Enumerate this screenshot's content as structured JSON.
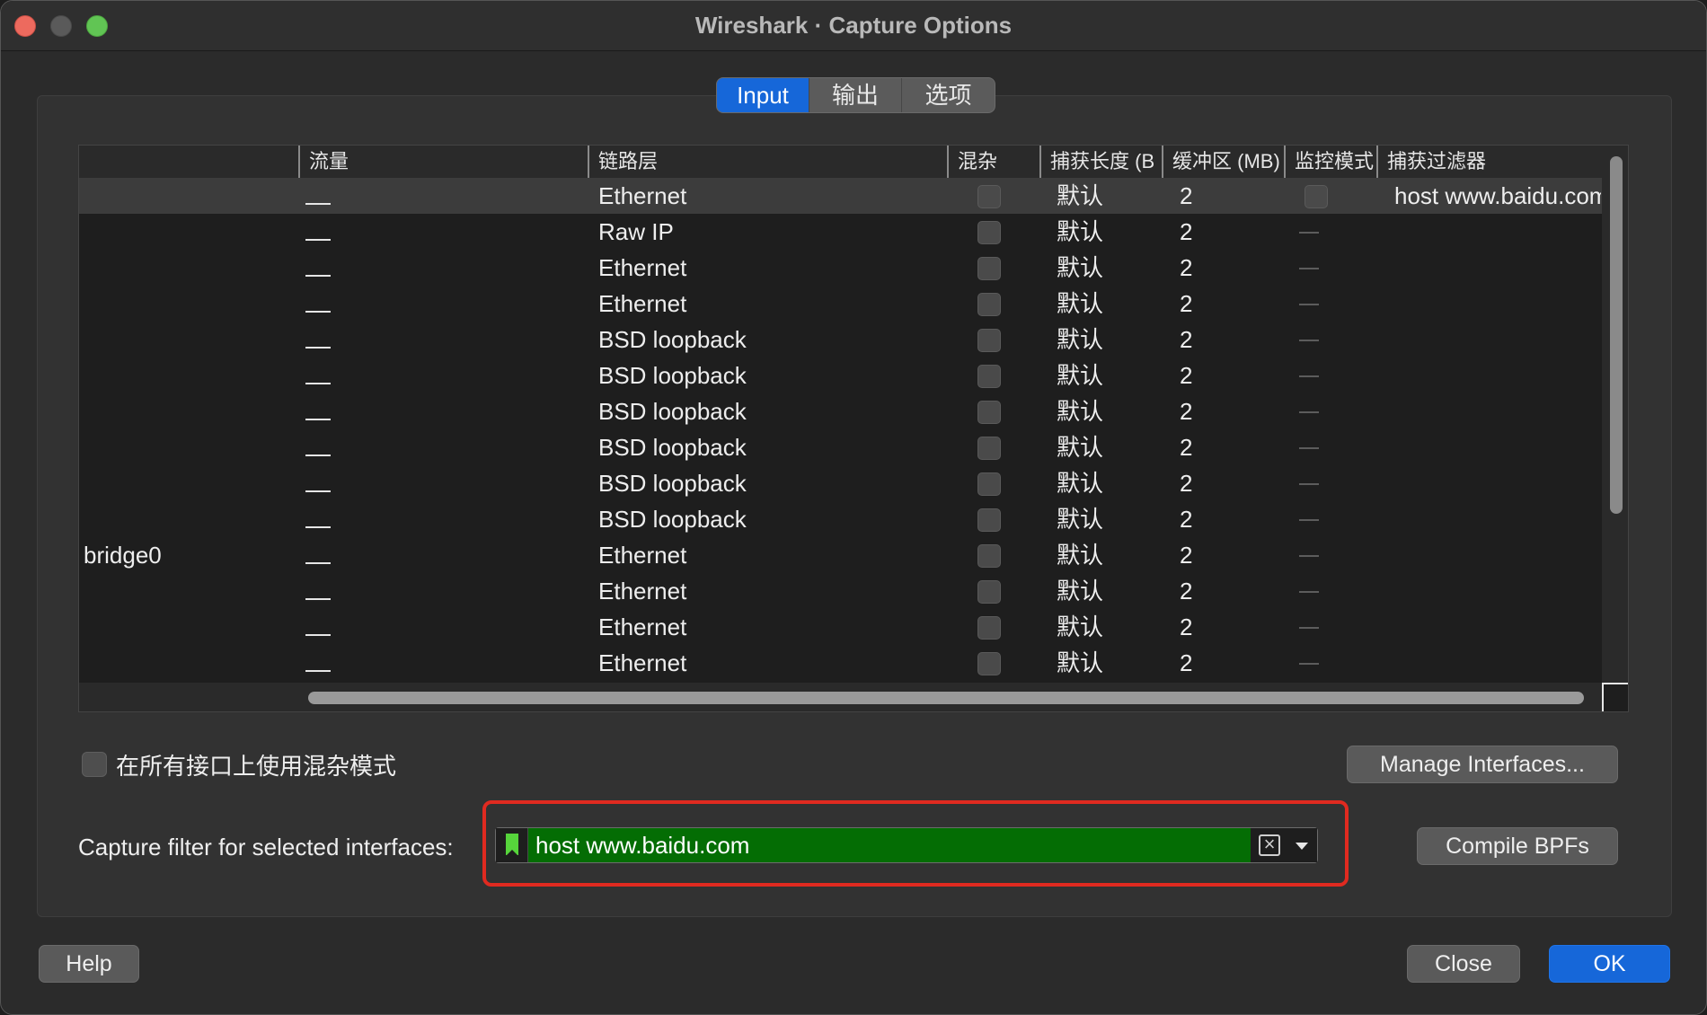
{
  "window": {
    "title": "Wireshark · Capture Options"
  },
  "tabs": [
    {
      "label": "Input",
      "active": true
    },
    {
      "label": "输出",
      "active": false
    },
    {
      "label": "选项",
      "active": false
    }
  ],
  "table": {
    "columns": [
      "",
      "流量",
      "链路层",
      "混杂",
      "捕获长度 (B",
      "缓冲区 (MB)",
      "监控模式",
      "捕获过滤器"
    ],
    "rows": [
      {
        "interface": "",
        "link": "Ethernet",
        "caplen": "默认",
        "buffer": "2",
        "filter": "host www.baidu.com",
        "selected": true
      },
      {
        "interface": "",
        "link": "Raw IP",
        "caplen": "默认",
        "buffer": "2",
        "filter": ""
      },
      {
        "interface": "",
        "link": "Ethernet",
        "caplen": "默认",
        "buffer": "2",
        "filter": ""
      },
      {
        "interface": "",
        "link": "Ethernet",
        "caplen": "默认",
        "buffer": "2",
        "filter": ""
      },
      {
        "interface": "",
        "link": "BSD loopback",
        "caplen": "默认",
        "buffer": "2",
        "filter": ""
      },
      {
        "interface": "",
        "link": "BSD loopback",
        "caplen": "默认",
        "buffer": "2",
        "filter": ""
      },
      {
        "interface": "",
        "link": "BSD loopback",
        "caplen": "默认",
        "buffer": "2",
        "filter": ""
      },
      {
        "interface": "",
        "link": "BSD loopback",
        "caplen": "默认",
        "buffer": "2",
        "filter": ""
      },
      {
        "interface": "",
        "link": "BSD loopback",
        "caplen": "默认",
        "buffer": "2",
        "filter": ""
      },
      {
        "interface": "",
        "link": "BSD loopback",
        "caplen": "默认",
        "buffer": "2",
        "filter": ""
      },
      {
        "interface": "bridge0",
        "link": "Ethernet",
        "caplen": "默认",
        "buffer": "2",
        "filter": ""
      },
      {
        "interface": "",
        "link": "Ethernet",
        "caplen": "默认",
        "buffer": "2",
        "filter": ""
      },
      {
        "interface": "",
        "link": "Ethernet",
        "caplen": "默认",
        "buffer": "2",
        "filter": ""
      },
      {
        "interface": "",
        "link": "Ethernet",
        "caplen": "默认",
        "buffer": "2",
        "filter": ""
      }
    ]
  },
  "options": {
    "promiscuous_label": "在所有接口上使用混杂模式",
    "manage_interfaces_label": "Manage Interfaces...",
    "capture_filter_label": "Capture filter for selected interfaces:",
    "capture_filter_value": "host www.baidu.com",
    "compile_bpfs_label": "Compile BPFs"
  },
  "footer": {
    "help_label": "Help",
    "close_label": "Close",
    "ok_label": "OK"
  },
  "colors": {
    "accent": "#1667d9",
    "filter_valid_bg": "#046d04",
    "highlight_border": "#e02a20"
  }
}
